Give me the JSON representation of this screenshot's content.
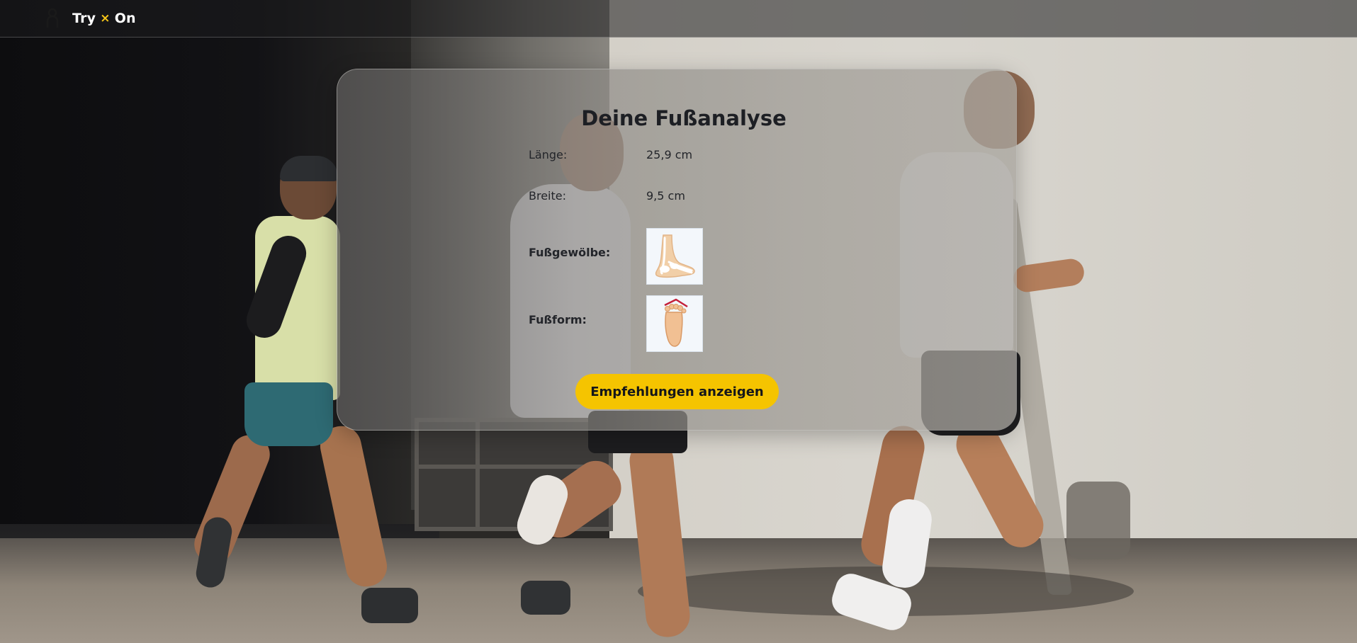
{
  "header": {
    "logo_icon": "on-brand-logo-icon",
    "brand_left": "Try",
    "brand_sep": "×",
    "brand_right": "On",
    "accent": "#f5c518"
  },
  "analysis": {
    "title": "Deine Fußanalyse",
    "rows": [
      {
        "label": "Länge:",
        "value": "25,9 cm"
      },
      {
        "label": "Breite:",
        "value": "9,5 cm"
      },
      {
        "label": "Fußgewölbe:",
        "icon": "foot-arch-xray-icon"
      },
      {
        "label": "Fußform:",
        "icon": "foot-shape-top-icon"
      }
    ],
    "cta_label": "Empfehlungen anzeigen",
    "cta_color": "#f5c400"
  }
}
